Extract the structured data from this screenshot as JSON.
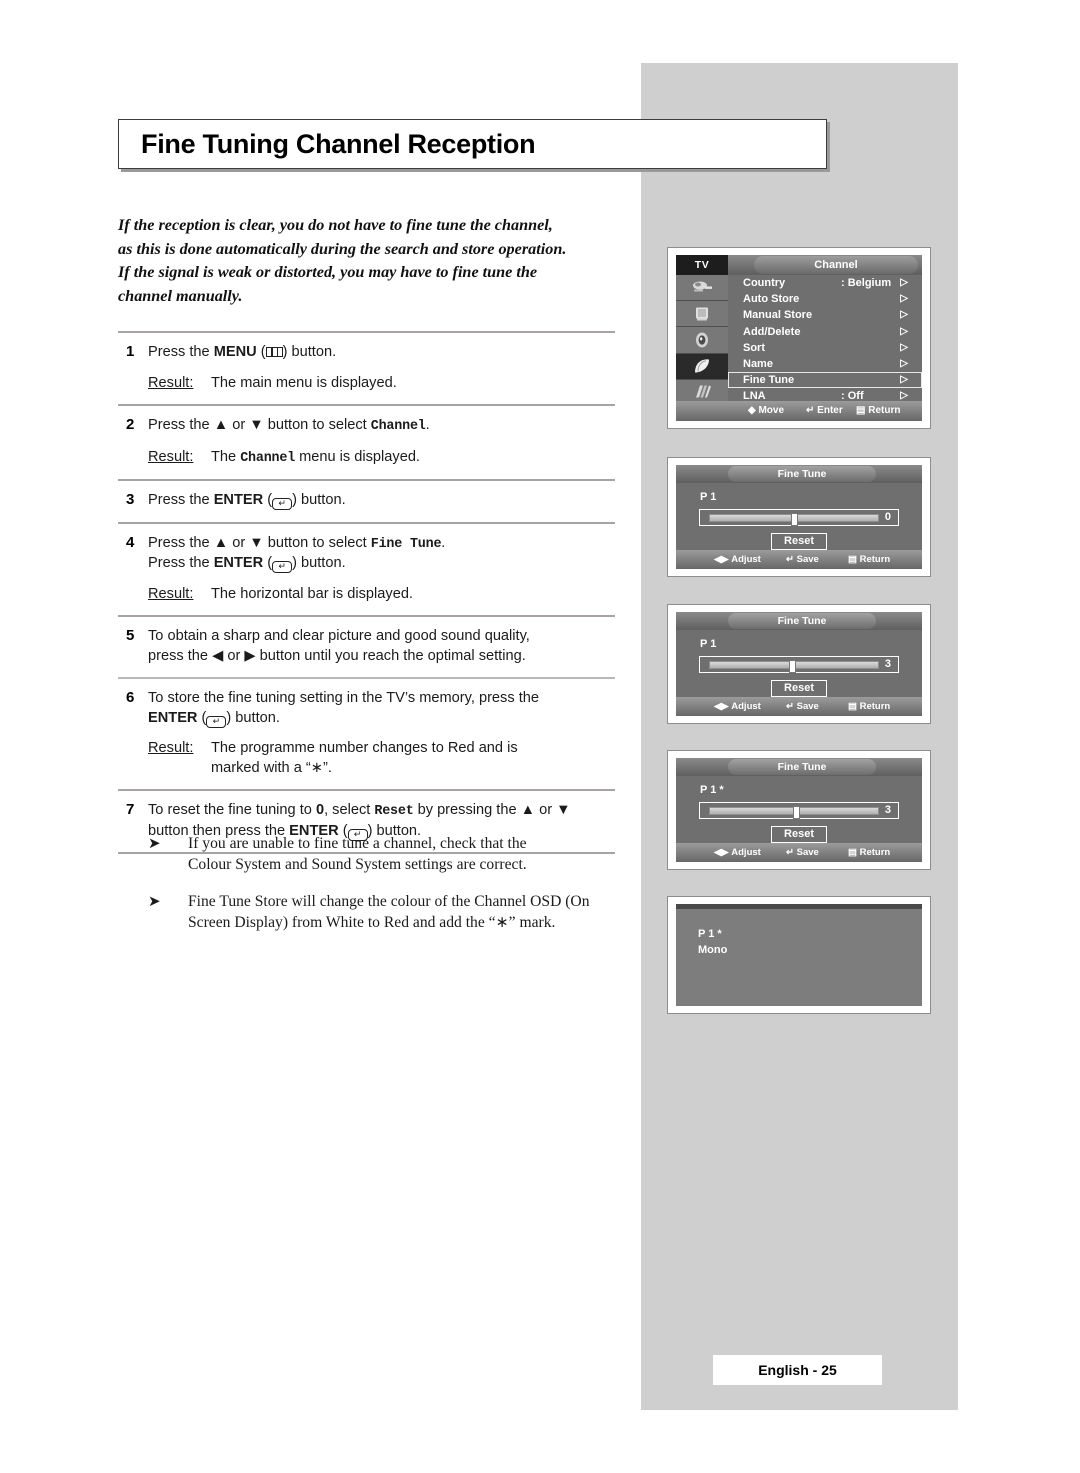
{
  "page": {
    "title": "Fine Tuning Channel Reception",
    "footer": "English - 25"
  },
  "intro": {
    "line1": "If the reception is clear, you do not have to fine tune the channel,",
    "line2": "as this is done automatically during the search and store operation.",
    "line3": "If the signal is weak or distorted, you may have to fine tune the",
    "line4": "channel manually."
  },
  "labels": {
    "result": "Result:",
    "press_the": "Press the",
    "button": "button",
    "or": "or"
  },
  "steps": [
    {
      "num": "1",
      "line1_a": "Press the ",
      "line1_key": "MENU",
      "line1_b": " (",
      "line1_c": ") button.",
      "result": "The main menu is displayed."
    },
    {
      "num": "2",
      "line1_a": "Press the ▲ or ▼ button to select ",
      "line1_mono": "Channel",
      "line1_b": ".",
      "result_a": "The ",
      "result_mono": "Channel",
      "result_b": " menu is displayed."
    },
    {
      "num": "3",
      "line1_a": "Press the ",
      "line1_key": "ENTER",
      "line1_b": " (",
      "line1_c": ") button."
    },
    {
      "num": "4",
      "line1_a": "Press the ▲ or ▼ button to select ",
      "line1_mono": "Fine Tune",
      "line1_b": ".",
      "line2_a": "Press the ",
      "line2_key": "ENTER",
      "line2_b": " (",
      "line2_c": ") button.",
      "result": "The horizontal bar is displayed."
    },
    {
      "num": "5",
      "line1": "To obtain a sharp and clear picture and good sound quality,",
      "line2": "press the ◀ or ▶ button until you reach the optimal setting."
    },
    {
      "num": "6",
      "line1": "To store the fine tuning setting in the TV’s memory, press the",
      "line2_key": "ENTER",
      "line2_b": " (",
      "line2_c": ") button.",
      "result_l1": "The programme number changes to Red and is",
      "result_l2": "marked with a “∗”."
    },
    {
      "num": "7",
      "line1_a": "To reset the fine tuning to ",
      "line1_zero": "0",
      "line1_b": ", select ",
      "line1_mono": "Reset",
      "line1_c": " by pressing the ▲ or ▼",
      "line2_a": "button then press the ",
      "line2_key": "ENTER",
      "line2_b": " (",
      "line2_c": ") button."
    }
  ],
  "notes": [
    {
      "bullet": "➤",
      "l1": "If you are unable to fine tune a channel, check that the",
      "l2": "Colour System and Sound System settings are correct."
    },
    {
      "bullet": "➤",
      "l1": "Fine Tune Store will change the colour of the Channel OSD (On",
      "l2": "Screen Display) from White to Red and add the “∗” mark."
    }
  ],
  "osd_menu": {
    "tv_tab": "TV",
    "title": "Channel",
    "icons": [
      {
        "name": "picture-icon",
        "selected": false
      },
      {
        "name": "tv-tube-icon",
        "selected": false
      },
      {
        "name": "sound-speaker-icon",
        "selected": false
      },
      {
        "name": "channel-dish-icon",
        "selected": true
      },
      {
        "name": "setup-icon",
        "selected": false
      }
    ],
    "items": [
      {
        "label": "Country",
        "value": ": Belgium",
        "chevron": "▷",
        "selected": false
      },
      {
        "label": "Auto Store",
        "value": "",
        "chevron": "▷",
        "selected": false
      },
      {
        "label": "Manual Store",
        "value": "",
        "chevron": "▷",
        "selected": false
      },
      {
        "label": "Add/Delete",
        "value": "",
        "chevron": "▷",
        "selected": false
      },
      {
        "label": "Sort",
        "value": "",
        "chevron": "▷",
        "selected": false
      },
      {
        "label": "Name",
        "value": "",
        "chevron": "▷",
        "selected": false
      },
      {
        "label": "Fine Tune",
        "value": "",
        "chevron": "▷",
        "selected": true
      },
      {
        "label": "LNA",
        "value": ": Off",
        "chevron": "▷",
        "selected": false
      }
    ],
    "bottom": {
      "move": "Move",
      "enter": "Enter",
      "return": "Return"
    }
  },
  "fine_tune_panels": [
    {
      "title": "Fine Tune",
      "programme": "P  1",
      "star": "",
      "value": "0",
      "knob_percent": 50,
      "reset": "Reset",
      "bottom": {
        "adjust": "Adjust",
        "save": "Save",
        "return": "Return"
      }
    },
    {
      "title": "Fine Tune",
      "programme": "P  1",
      "star": "",
      "value": "3",
      "knob_percent": 49,
      "reset": "Reset",
      "bottom": {
        "adjust": "Adjust",
        "save": "Save",
        "return": "Return"
      }
    },
    {
      "title": "Fine Tune",
      "programme": "P  1",
      "star": "*",
      "value": "3",
      "knob_percent": 51,
      "reset": "Reset",
      "bottom": {
        "adjust": "Adjust",
        "save": "Save",
        "return": "Return"
      }
    }
  ],
  "osd_mono": {
    "line1": "P  1 *",
    "line2": "Mono"
  }
}
